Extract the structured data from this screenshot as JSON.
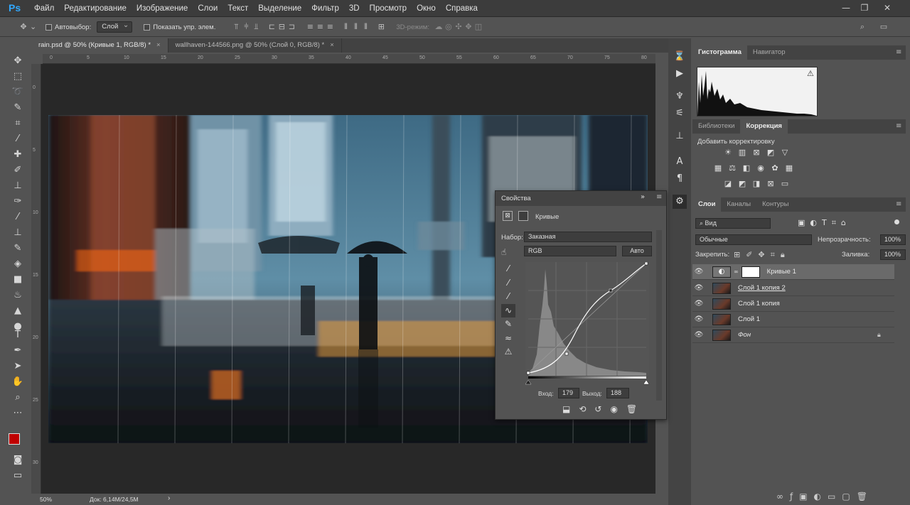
{
  "app": {
    "logo": "Ps"
  },
  "menu": [
    "Файл",
    "Редактирование",
    "Изображение",
    "Слои",
    "Текст",
    "Выделение",
    "Фильтр",
    "3D",
    "Просмотр",
    "Окно",
    "Справка"
  ],
  "window_controls": {
    "minimize": "—",
    "restore": "❐",
    "close": "✕"
  },
  "options_bar": {
    "autoselect_label": "Автовыбор:",
    "autoselect_value": "Слой",
    "show_transform_label": "Показать упр. элем.",
    "mode3d_label": "3D-режим:"
  },
  "tabs": [
    {
      "label": "rain.psd @ 50% (Кривые 1, RGB/8) *",
      "close": "×",
      "active": true
    },
    {
      "label": "wallhaven-144566.png @ 50% (Слой 0, RGB/8) *",
      "close": "×",
      "active": false
    }
  ],
  "ruler_top": [
    "0",
    "5",
    "10",
    "15",
    "20",
    "25",
    "30",
    "35",
    "40",
    "45",
    "50",
    "55",
    "60",
    "65",
    "70",
    "75",
    "80"
  ],
  "ruler_left": [
    "0",
    "5",
    "10",
    "15",
    "20",
    "25",
    "30"
  ],
  "status": {
    "zoom": "50%",
    "doc": "Док: 6,14M/24,5M"
  },
  "properties": {
    "title": "Свойства",
    "panel_name": "Кривые",
    "preset_label": "Набор:",
    "preset_value": "Заказная",
    "channel_value": "RGB",
    "auto_button": "Авто",
    "input_label": "Вход:",
    "input_value": "179",
    "output_label": "Выход:",
    "output_value": "188"
  },
  "histogram_panel": {
    "tabs": [
      "Гистограмма",
      "Навигатор"
    ],
    "warning": "⚠"
  },
  "adjustments_panel": {
    "tabs": [
      "Библиотеки",
      "Коррекция"
    ],
    "title": "Добавить корректировку"
  },
  "layers_panel": {
    "tabs": [
      "Слои",
      "Каналы",
      "Контуры"
    ],
    "filter_kind": "Вид",
    "blend_mode": "Обычные",
    "opacity_label": "Непрозрачность:",
    "opacity_value": "100%",
    "lock_label": "Закрепить:",
    "fill_label": "Заливка:",
    "fill_value": "100%",
    "layers": [
      {
        "name": "Кривые 1",
        "selected": true,
        "type": "adjustment"
      },
      {
        "name": "Слой 1 копия 2",
        "selected": false,
        "type": "pixel"
      },
      {
        "name": "Слой 1 копия",
        "selected": false,
        "type": "pixel"
      },
      {
        "name": "Слой 1",
        "selected": false,
        "type": "pixel"
      },
      {
        "name": "Фон",
        "selected": false,
        "type": "background",
        "locked": true
      }
    ]
  },
  "colors": {
    "foreground": "#c00000",
    "background": "#ffffff",
    "accent": "#31a8ff"
  }
}
